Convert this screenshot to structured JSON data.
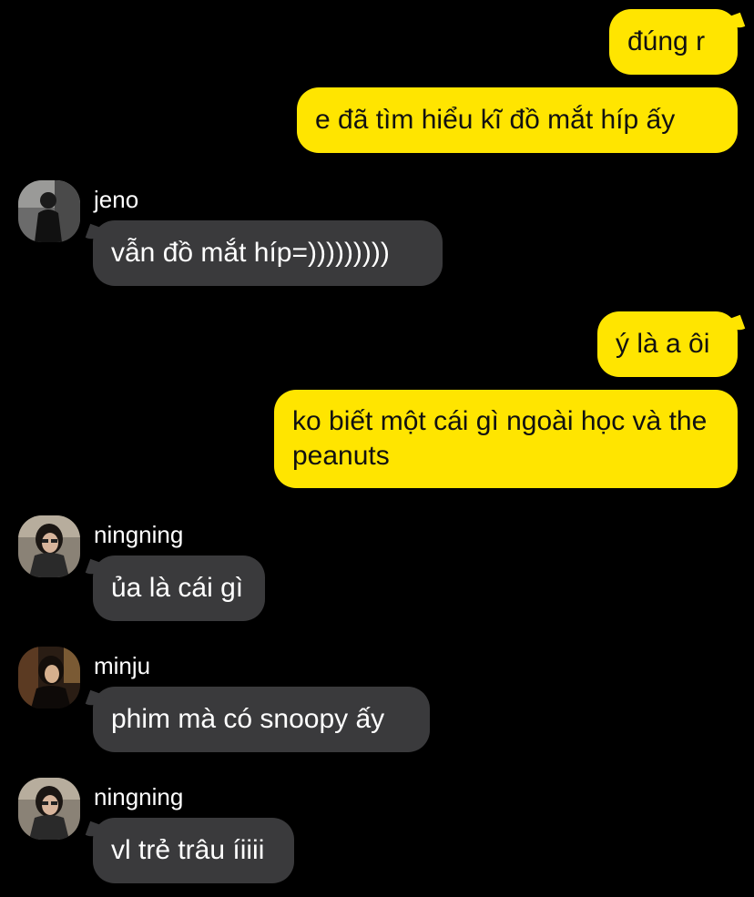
{
  "messages": [
    {
      "sender": "me",
      "text": "đúng r"
    },
    {
      "sender": "me",
      "text": "e đã tìm hiểu kĩ đồ mắt híp ấy"
    },
    {
      "sender": "jeno",
      "text": "vẫn đồ mắt híp=)))))))))"
    },
    {
      "sender": "me",
      "text": "ý là a ôi"
    },
    {
      "sender": "me",
      "text": "ko biết một cái gì ngoài học và the peanuts"
    },
    {
      "sender": "ningning",
      "text": "ủa là cái gì"
    },
    {
      "sender": "minju",
      "text": "phim mà có snoopy ấy"
    },
    {
      "sender": "ningning",
      "text": "vl trẻ trâu íiiii"
    }
  ],
  "senders": {
    "jeno": "jeno",
    "ningning_1": "ningning",
    "minju": "minju",
    "ningning_2": "ningning"
  },
  "colors": {
    "background": "#000000",
    "outgoing_bubble": "#ffe500",
    "incoming_bubble": "#3a3a3c"
  }
}
